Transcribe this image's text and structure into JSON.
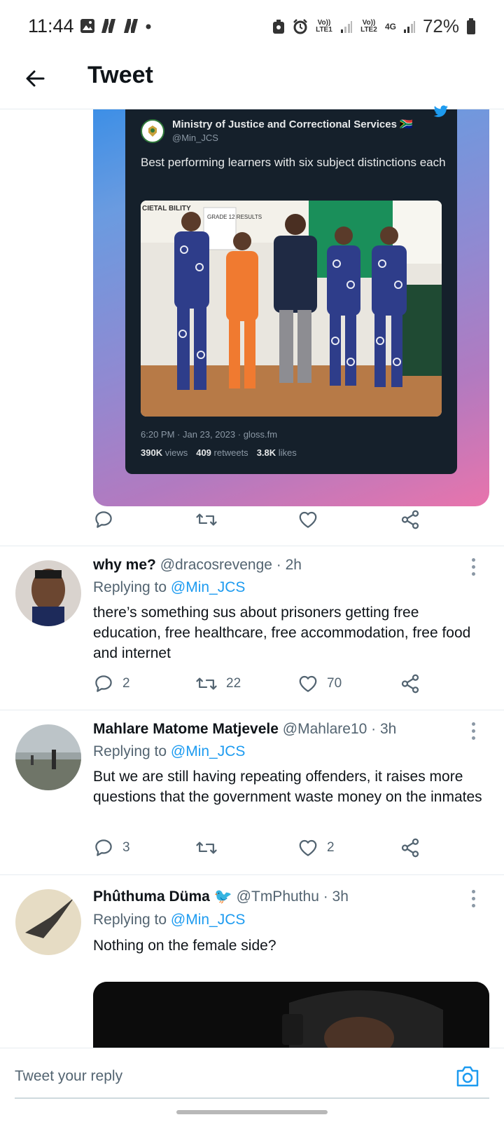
{
  "status_bar": {
    "time": "11:44",
    "lte1_label": "Vo)) LTE1",
    "lte2_label": "Vo)) LTE2",
    "network": "4G",
    "battery": "72%"
  },
  "header": {
    "title": "Tweet"
  },
  "quoted_tweet": {
    "author_name": "Ministry of Justice and Correctional Services 🇿🇦",
    "author_handle": "@Min_JCS",
    "text": "Best performing learners with six subject distinctions each",
    "timestamp": "6:20 PM · Jan 23, 2023 · gloss.fm",
    "views_count": "390K",
    "views_label": "views",
    "retweets_count": "409",
    "retweets_label": "retweets",
    "likes_count": "3.8K",
    "likes_label": "likes",
    "photo_banner_left": "CIETAL BILITY",
    "photo_banner_grade": "GRADE 12 RESULTS"
  },
  "replies": [
    {
      "name": "why me?",
      "handle": "@dracosrevenge · 2h",
      "replying_prefix": "Replying to",
      "replying_to": "@Min_JCS",
      "text": "there’s something sus about prisoners getting free education, free healthcare, free accommodation, free food and internet",
      "reply_count": "2",
      "retweet_count": "22",
      "like_count": "70"
    },
    {
      "name": "Mahlare Matome Matjevele",
      "handle": "@Mahlare10 · 3h",
      "replying_prefix": "Replying to",
      "replying_to": "@Min_JCS",
      "text": "But we are still having repeating offenders, it raises more questions that the government waste money on the inmates",
      "reply_count": "3",
      "retweet_count": "",
      "like_count": "2"
    },
    {
      "name": "Phûthuma Düma 🐦",
      "handle": "@TmPhuthu · 3h",
      "replying_prefix": "Replying to",
      "replying_to": "@Min_JCS",
      "text": "Nothing on the female side?"
    }
  ],
  "compose": {
    "placeholder": "Tweet your reply"
  },
  "colors": {
    "accent": "#1d9bf0",
    "text": "#0f1419",
    "muted": "#536471",
    "card_dark": "#15202b"
  }
}
